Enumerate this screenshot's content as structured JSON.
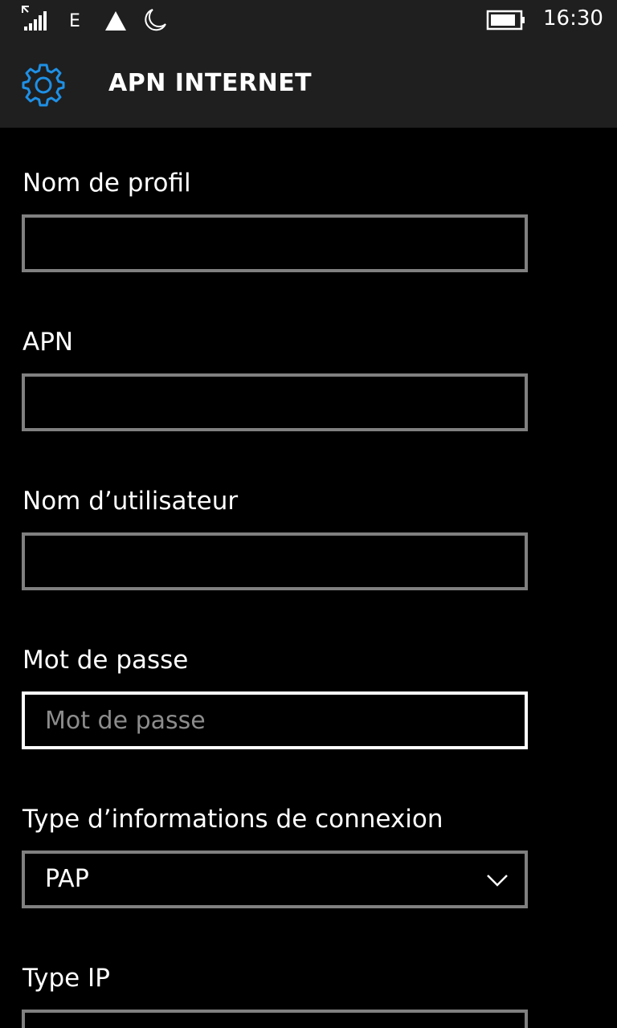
{
  "status_bar": {
    "network_type": "E",
    "time": "16:30",
    "icons": [
      "signal-icon",
      "wifi-icon",
      "moon-icon",
      "battery-icon"
    ]
  },
  "header": {
    "icon": "gear-icon",
    "title": "APN INTERNET"
  },
  "form": {
    "profile_name": {
      "label": "Nom de profil",
      "value": "",
      "placeholder": ""
    },
    "apn": {
      "label": "APN",
      "value": "",
      "placeholder": ""
    },
    "username": {
      "label": "Nom d’utilisateur",
      "value": "",
      "placeholder": ""
    },
    "password": {
      "label": "Mot de passe",
      "value": "",
      "placeholder": "Mot de passe"
    },
    "auth_type": {
      "label": "Type d’informations de connexion",
      "selected": "PAP"
    },
    "ip_type": {
      "label": "Type IP"
    }
  },
  "colors": {
    "background": "#000000",
    "bar_background": "#1f1f1f",
    "accent": "#1e90e6",
    "field_border": "#808080",
    "field_border_focused": "#ffffff"
  }
}
